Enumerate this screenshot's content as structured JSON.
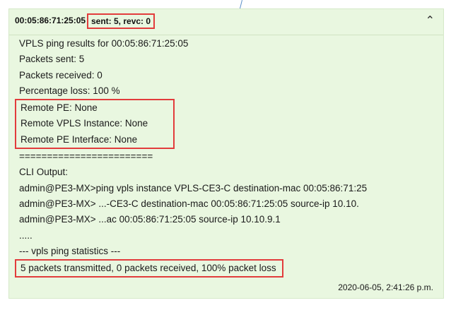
{
  "header": {
    "device_id": "00:05:86:71:25:05",
    "status": "sent: 5, revc: 0",
    "collapse_icon": "chevron-up-icon"
  },
  "result": {
    "title": "VPLS ping results for 00:05:86:71:25:05",
    "packets_sent": "Packets sent: 5",
    "packets_received": "Packets received: 0",
    "percentage_loss": "Percentage loss: 100 %",
    "remote_pe": "Remote PE: None",
    "remote_vpls_instance": "Remote VPLS Instance: None",
    "remote_pe_interface": "Remote PE Interface: None",
    "separator": "========================",
    "cli_output_label": "CLI Output:",
    "cli_lines": [
      "admin@PE3-MX>ping vpls instance VPLS-CE3-C destination-mac 00:05:86:71:25",
      "admin@PE3-MX> ...-CE3-C destination-mac 00:05:86:71:25:05 source-ip 10.10.",
      "admin@PE3-MX> ...ac 00:05:86:71:25:05 source-ip 10.10.9.1"
    ],
    "ellipsis": ".....",
    "stats_header": "--- vpls ping statistics ---",
    "stats_summary": "5 packets transmitted, 0 packets received, 100% packet loss"
  },
  "footer": {
    "timestamp": "2020-06-05, 2:41:26 p.m."
  },
  "colors": {
    "panel_bg": "#e9f7e0",
    "highlight_border": "#e23c3c"
  }
}
